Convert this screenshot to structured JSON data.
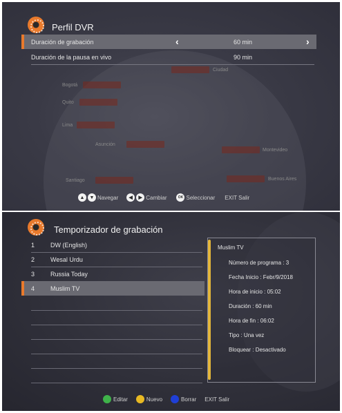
{
  "dvr": {
    "title": "Perfil DVR",
    "rows": [
      {
        "label": "Duración de grabación",
        "value": "60 min",
        "left_arrow": "‹",
        "right_arrow": "›"
      },
      {
        "label": "Duración de la pausa en vivo",
        "value": "90 min"
      }
    ],
    "footer": {
      "navigate_label": "Navegar",
      "change_label": "Cambiar",
      "select_key": "OK",
      "select_label": "Seleccionar",
      "exit_label": "EXIT Salir"
    }
  },
  "timer": {
    "title": "Temporizador de grabación",
    "items": [
      {
        "num": "1",
        "name": "DW (English)"
      },
      {
        "num": "2",
        "name": "Wesal Urdu"
      },
      {
        "num": "3",
        "name": "Russia Today"
      },
      {
        "num": "4",
        "name": "Muslim TV"
      }
    ],
    "selected_index": 3,
    "details": {
      "channel": "Muslim TV",
      "program_number": "Número de programa : 3",
      "start_date": "Fecha Inicio : Febr/9/2018",
      "start_time": "Hora de inicio : 05:02",
      "duration": "Duración : 60 min",
      "end_time": "Hora de fin : 06:02",
      "type": "Tipo : Una vez",
      "lock": "Bloquear : Desactivado"
    },
    "footer": {
      "edit_label": "Editar",
      "new_label": "Nuevo",
      "delete_label": "Borrar",
      "exit_label": "EXIT Salir"
    }
  },
  "colors": {
    "accent": "#e97a2c",
    "green": "#3fb34a",
    "yellow": "#e8b923",
    "blue": "#1f3fd6",
    "details_bar": "#e3b63a"
  },
  "background_map_labels": [
    "Bogotá",
    "Quito",
    "Lima",
    "Asunción",
    "Santiago",
    "Buenos Aires",
    "Ciudad",
    "Montevideo"
  ]
}
